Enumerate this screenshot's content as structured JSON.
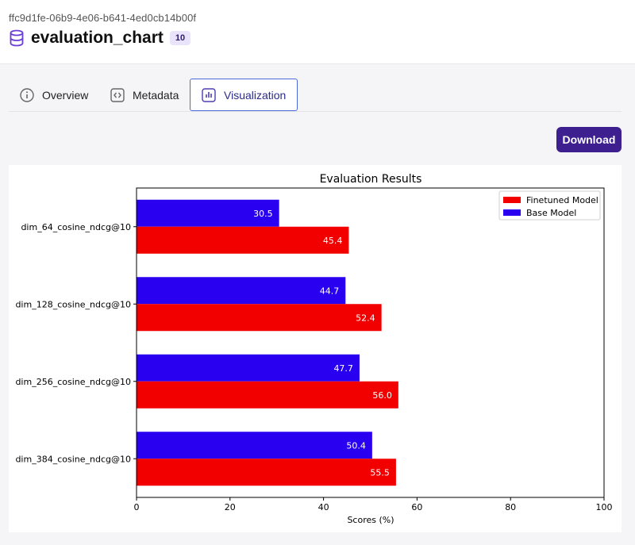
{
  "artifact": {
    "id": "ffc9d1fe-06b9-4e06-b641-4ed0cb14b00f",
    "title": "evaluation_chart",
    "badge": "10",
    "icon": "database-icon"
  },
  "tabs": [
    {
      "label": "Overview",
      "icon": "info-icon"
    },
    {
      "label": "Metadata",
      "icon": "code-icon"
    },
    {
      "label": "Visualization",
      "icon": "bar-chart-icon",
      "active": true
    }
  ],
  "actions": {
    "download_label": "Download"
  },
  "colors": {
    "accent": "#3d1f8f",
    "finetuned": "#f20000",
    "base": "#2a00f0"
  },
  "chart_data": {
    "type": "bar",
    "orientation": "horizontal",
    "title": "Evaluation Results",
    "xlabel": "Scores (%)",
    "ylabel": "",
    "xlim": [
      0,
      100
    ],
    "xticks": [
      0,
      20,
      40,
      60,
      80,
      100
    ],
    "categories": [
      "dim_64_cosine_ndcg@10",
      "dim_128_cosine_ndcg@10",
      "dim_256_cosine_ndcg@10",
      "dim_384_cosine_ndcg@10"
    ],
    "series": [
      {
        "name": "Base Model",
        "color": "#2a00f0",
        "values": [
          30.5,
          44.7,
          47.7,
          50.4
        ],
        "labels": [
          "30.5",
          "44.7",
          "47.7",
          "50.4"
        ]
      },
      {
        "name": "Finetuned Model",
        "color": "#f20000",
        "values": [
          45.4,
          52.4,
          56.0,
          55.5
        ],
        "labels": [
          "45.4",
          "52.4",
          "56.0",
          "55.5"
        ]
      }
    ],
    "legend": {
      "position": "top-right",
      "order": [
        "Finetuned Model",
        "Base Model"
      ]
    },
    "grid": false
  }
}
